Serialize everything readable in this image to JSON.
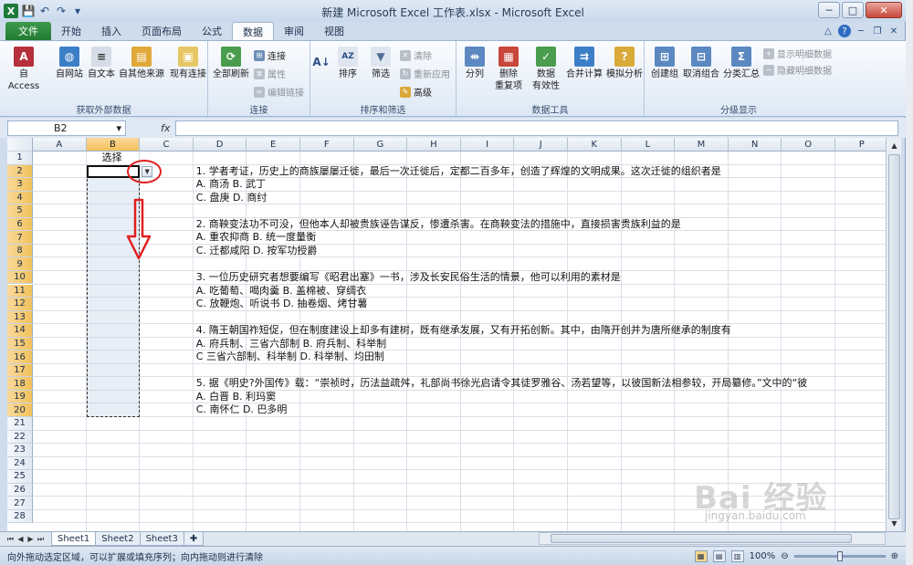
{
  "window": {
    "title": "新建 Microsoft Excel 工作表.xlsx - Microsoft Excel"
  },
  "ribbon_tabs": [
    {
      "label": "文件"
    },
    {
      "label": "开始"
    },
    {
      "label": "插入"
    },
    {
      "label": "页面布局"
    },
    {
      "label": "公式"
    },
    {
      "label": "数据"
    },
    {
      "label": "审阅"
    },
    {
      "label": "视图"
    }
  ],
  "ribbon": {
    "external": {
      "group_label": "获取外部数据",
      "access": "自 Access",
      "web": "自网站",
      "text": "自文本",
      "other": "自其他来源",
      "existing": "现有连接"
    },
    "connections": {
      "group_label": "连接",
      "refresh_all": "全部刷新",
      "connections": "连接",
      "properties": "属性",
      "edit_links": "编辑链接"
    },
    "sort_filter": {
      "group_label": "排序和筛选",
      "sort": "排序",
      "filter": "筛选",
      "clear": "清除",
      "reapply": "重新应用",
      "advanced": "高级"
    },
    "data_tools": {
      "group_label": "数据工具",
      "text_to_columns": "分列",
      "remove_dup_1": "删除",
      "remove_dup_2": "重复项",
      "validation_1": "数据",
      "validation_2": "有效性",
      "consolidate": "合并计算",
      "what_if": "模拟分析"
    },
    "outline": {
      "group_label": "分级显示",
      "group": "创建组",
      "ungroup": "取消组合",
      "subtotal": "分类汇总",
      "show_detail": "显示明细数据",
      "hide_detail": "隐藏明细数据"
    }
  },
  "formula_bar": {
    "name_box": "B2",
    "fx": "fx",
    "value": ""
  },
  "columns": [
    "A",
    "B",
    "C",
    "D",
    "E",
    "F",
    "G",
    "H",
    "I",
    "J",
    "K",
    "L",
    "M",
    "N",
    "O",
    "P"
  ],
  "rows": [
    "1",
    "2",
    "3",
    "4",
    "5",
    "6",
    "7",
    "8",
    "9",
    "10",
    "11",
    "12",
    "13",
    "14",
    "15",
    "16",
    "17",
    "18",
    "19",
    "20",
    "21",
    "22",
    "23",
    "24",
    "25",
    "26",
    "27",
    "28"
  ],
  "cells": {
    "B1": "选择",
    "D2": "1. 学者考证，历史上的商族屡屡迁徙，最后一次迁徙后，定都二百多年，创造了辉煌的文明成果。这次迁徙的组织者是",
    "D3": "A. 商汤 B. 武丁",
    "D4": "C. 盘庚 D. 商纣",
    "D6": "2. 商鞅变法功不可没，但他本人却被贵族诬告谋反，惨遭杀害。在商鞅变法的措施中，直接损害贵族利益的是",
    "D7": "A. 重农抑商 B. 统一度量衡",
    "D8": "C. 迁都咸阳 D. 按军功授爵",
    "D10": "3. 一位历史研究者想要编写《昭君出塞》一书，涉及长安民俗生活的情景，他可以利用的素材是",
    "D11": "A. 吃葡萄、喝肉羹 B. 盖棉被、穿绸衣",
    "D12": "C. 放鞭炮、听说书 D. 抽卷烟、烤甘薯",
    "D14": "4. 隋王朝国祚短促，但在制度建设上却多有建树，既有继承发展，又有开拓创新。其中，由隋开创并为唐所继承的制度有",
    "D15": "A. 府兵制、三省六部制 B. 府兵制、科举制",
    "D16": "C 三省六部制、科举制 D. 科举制、均田制",
    "D18": "5. 据《明史?外国传》载：“崇祯时，历法益疏舛，礼部尚书徐光启请令其徒罗雅谷、汤若望等，以彼国新法相参较，开局纂修。”文中的“彼",
    "D19": "A. 白晋 B. 利玛窦",
    "D20": "C. 南怀仁 D. 巴多明"
  },
  "sheet_tabs": [
    {
      "label": "Sheet1"
    },
    {
      "label": "Sheet2"
    },
    {
      "label": "Sheet3"
    }
  ],
  "status": {
    "message": "向外拖动选定区域，可以扩展或填充序列；向内拖动则进行清除",
    "zoom": "100%"
  },
  "watermark": {
    "text": "Bai 经验",
    "url": "jingyan.baidu.com"
  }
}
